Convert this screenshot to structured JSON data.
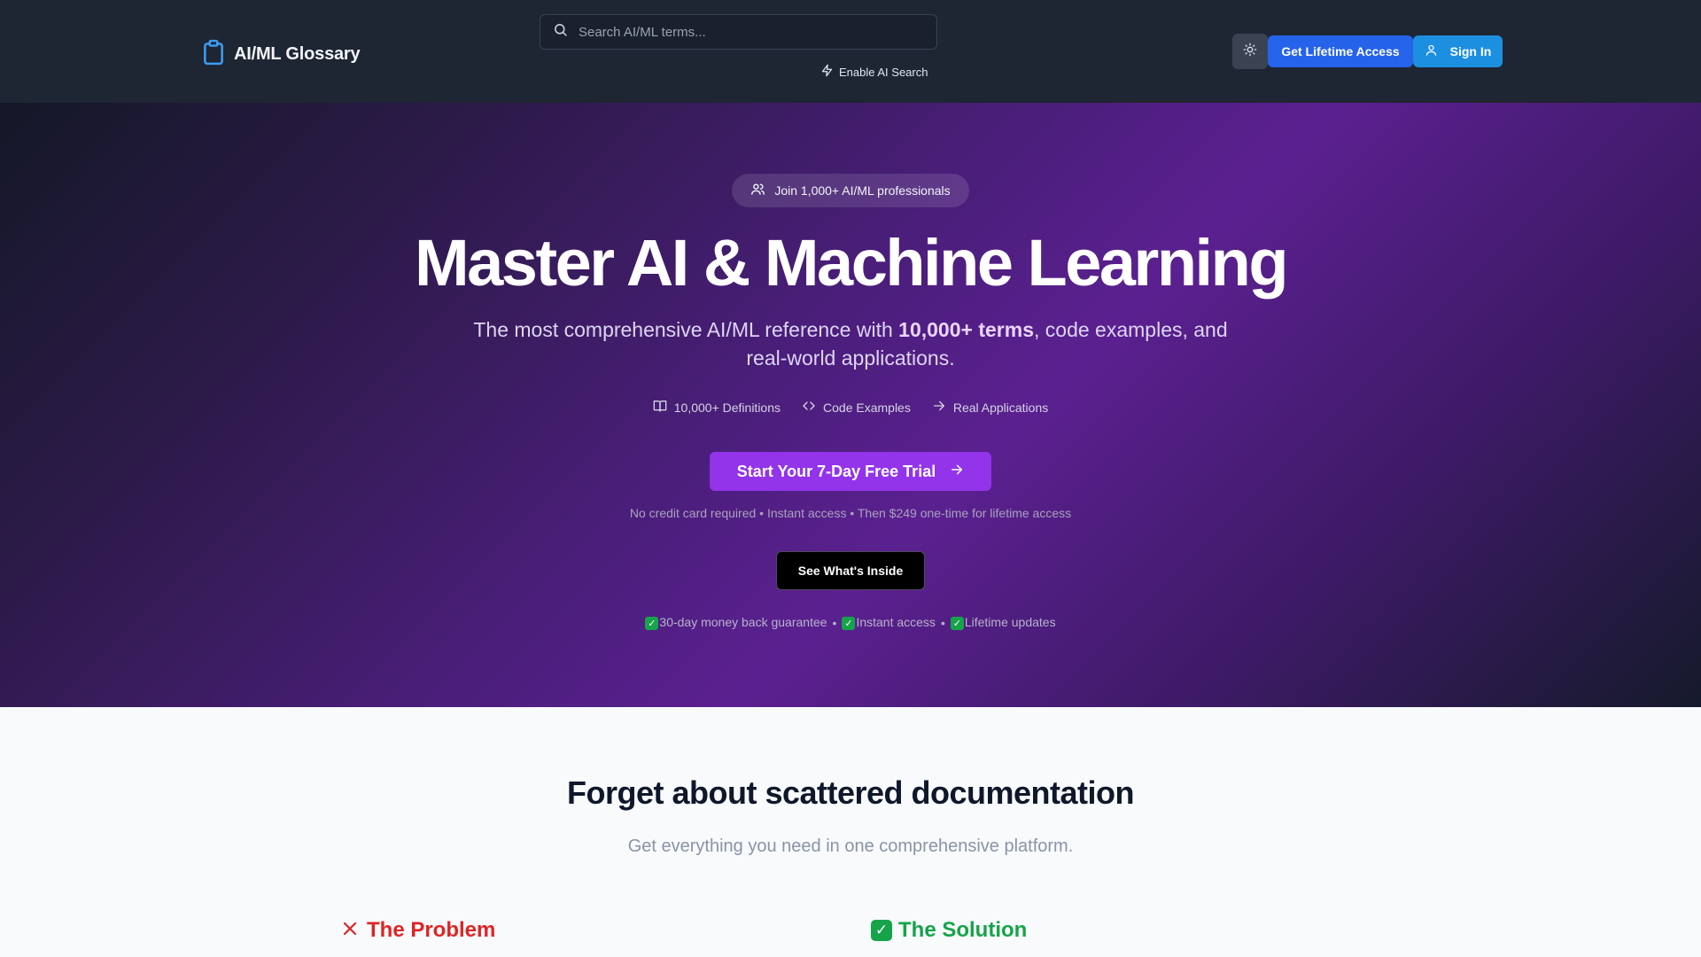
{
  "header": {
    "logo_text": "AI/ML Glossary",
    "search_placeholder": "Search AI/ML terms...",
    "ai_search_label": "Enable AI Search",
    "lifetime_label": "Get Lifetime Access",
    "signin_label": "Sign In"
  },
  "hero": {
    "badge": "Join 1,000+ AI/ML professionals",
    "title": "Master AI & Machine Learning",
    "subtitle_pre": "The most comprehensive AI/ML reference with ",
    "subtitle_highlight": "10,000+ terms",
    "subtitle_post": ", code examples, and real-world applications.",
    "features": [
      "10,000+ Definitions",
      "Code Examples",
      "Real Applications"
    ],
    "cta_label": "Start Your 7-Day Free Trial",
    "fine_print": "No credit card required • Instant access • Then $249 one-time for lifetime access",
    "see_inside_label": "See What's Inside",
    "guarantees": [
      "30-day money back guarantee",
      "Instant access",
      "Lifetime updates"
    ],
    "guarantee_separator": "•"
  },
  "section": {
    "title": "Forget about scattered documentation",
    "subtitle": "Get everything you need in one comprehensive platform.",
    "problem_label": "The Problem",
    "solution_label": "The Solution"
  },
  "colors": {
    "header_bg": "#1e2533",
    "accent_blue": "#2563eb",
    "signin_blue": "#1d8fe0",
    "cta_purple": "#9333ea",
    "problem_red": "#dc2626",
    "solution_green": "#16a34a"
  },
  "icons": {
    "logo": "clipboard-icon",
    "search": "search-icon",
    "ai_search": "lightning-icon",
    "theme": "sun-icon",
    "signin": "user-icon",
    "badge": "users-icon",
    "features": [
      "book-icon",
      "code-icon",
      "arrow-right-icon"
    ],
    "cta": "arrow-right-icon",
    "guarantee": "check-box-icon",
    "problem": "x-icon",
    "solution": "check-box-icon"
  }
}
